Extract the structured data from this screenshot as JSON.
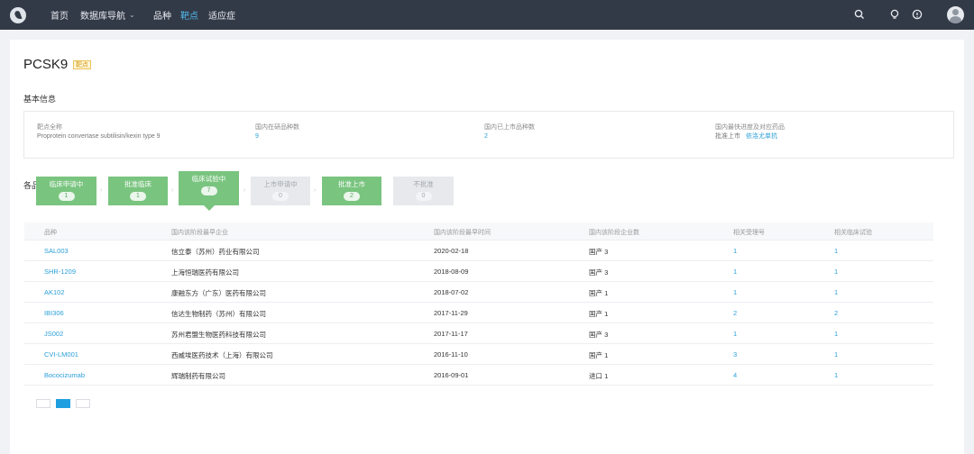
{
  "nav": {
    "items": [
      {
        "label": "首页"
      },
      {
        "label": "数据库导航"
      },
      {
        "label": "品种"
      },
      {
        "label": "靶点"
      },
      {
        "label": "适应症"
      }
    ],
    "active_index": 3
  },
  "page": {
    "title": "PCSK9",
    "title_badge": "靶点"
  },
  "basic_info": {
    "section_title": "基本信息",
    "fields": [
      {
        "label": "靶点全称",
        "value": "Proprotein convertase subtilisin/kexin type 9"
      },
      {
        "label": "国内在研品种数",
        "value": "9"
      },
      {
        "label": "国内已上市品种数",
        "value": "2"
      },
      {
        "label": "国内最快进度及对应药品",
        "status": "批准上市",
        "drug": "依洛尤单抗"
      }
    ]
  },
  "progress": {
    "section_title": "各品种进度",
    "stages": [
      {
        "label": "临床申请中",
        "count": "1"
      },
      {
        "label": "批准临床",
        "count": "1"
      },
      {
        "label": "临床试验中",
        "count": "7"
      },
      {
        "label": "上市申请中",
        "count": "0"
      },
      {
        "label": "批准上市",
        "count": "2"
      },
      {
        "label": "不批准",
        "count": "0"
      }
    ]
  },
  "table": {
    "headers": [
      "品种",
      "国内该阶段最早企业",
      "国内该阶段最早时间",
      "国内该阶段企业数",
      "相关受理号",
      "相关临床试验"
    ],
    "rows": [
      [
        "SAL003",
        "信立泰（苏州）药业有限公司",
        "2020-02-18",
        "国产 3",
        "1",
        "1"
      ],
      [
        "SHR-1209",
        "上海恒瑞医药有限公司",
        "2018-08-09",
        "国产 3",
        "1",
        "1"
      ],
      [
        "AK102",
        "康融东方（广东）医药有限公司",
        "2018-07-02",
        "国产 1",
        "1",
        "1"
      ],
      [
        "IBI306",
        "信达生物制药（苏州）有限公司",
        "2017-11-29",
        "国产 1",
        "2",
        "2"
      ],
      [
        "JS002",
        "苏州君盟生物医药科技有限公司",
        "2017-11-17",
        "国产 3",
        "1",
        "1"
      ],
      [
        "CVI-LM001",
        "西威埃医药技术（上海）有限公司",
        "2016-11-10",
        "国产 1",
        "3",
        "1"
      ],
      [
        "Bococizumab",
        "辉瑞制药有限公司",
        "2016-09-01",
        "进口 1",
        "4",
        "1"
      ]
    ]
  },
  "pagination": {
    "active_page": 2
  }
}
